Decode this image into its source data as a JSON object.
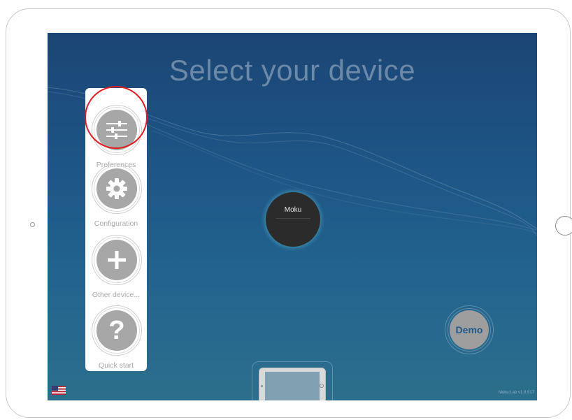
{
  "screen": {
    "title": "Select your device",
    "version": "Moku:Lab v1.8.917"
  },
  "menu": {
    "items": [
      {
        "label": "Preferences",
        "icon": "sliders-icon"
      },
      {
        "label": "Configuration",
        "icon": "gear-icon"
      },
      {
        "label": "Other device...",
        "icon": "plus-icon"
      },
      {
        "label": "Quick start",
        "icon": "question-icon",
        "glyph": "?"
      }
    ]
  },
  "device": {
    "name": "Moku"
  },
  "demo": {
    "label": "Demo"
  },
  "language_flag": "us-flag-icon",
  "colors": {
    "highlight": "#e01e24",
    "accent": "#1f5a8a",
    "button_gray": "#a7a7a7"
  }
}
